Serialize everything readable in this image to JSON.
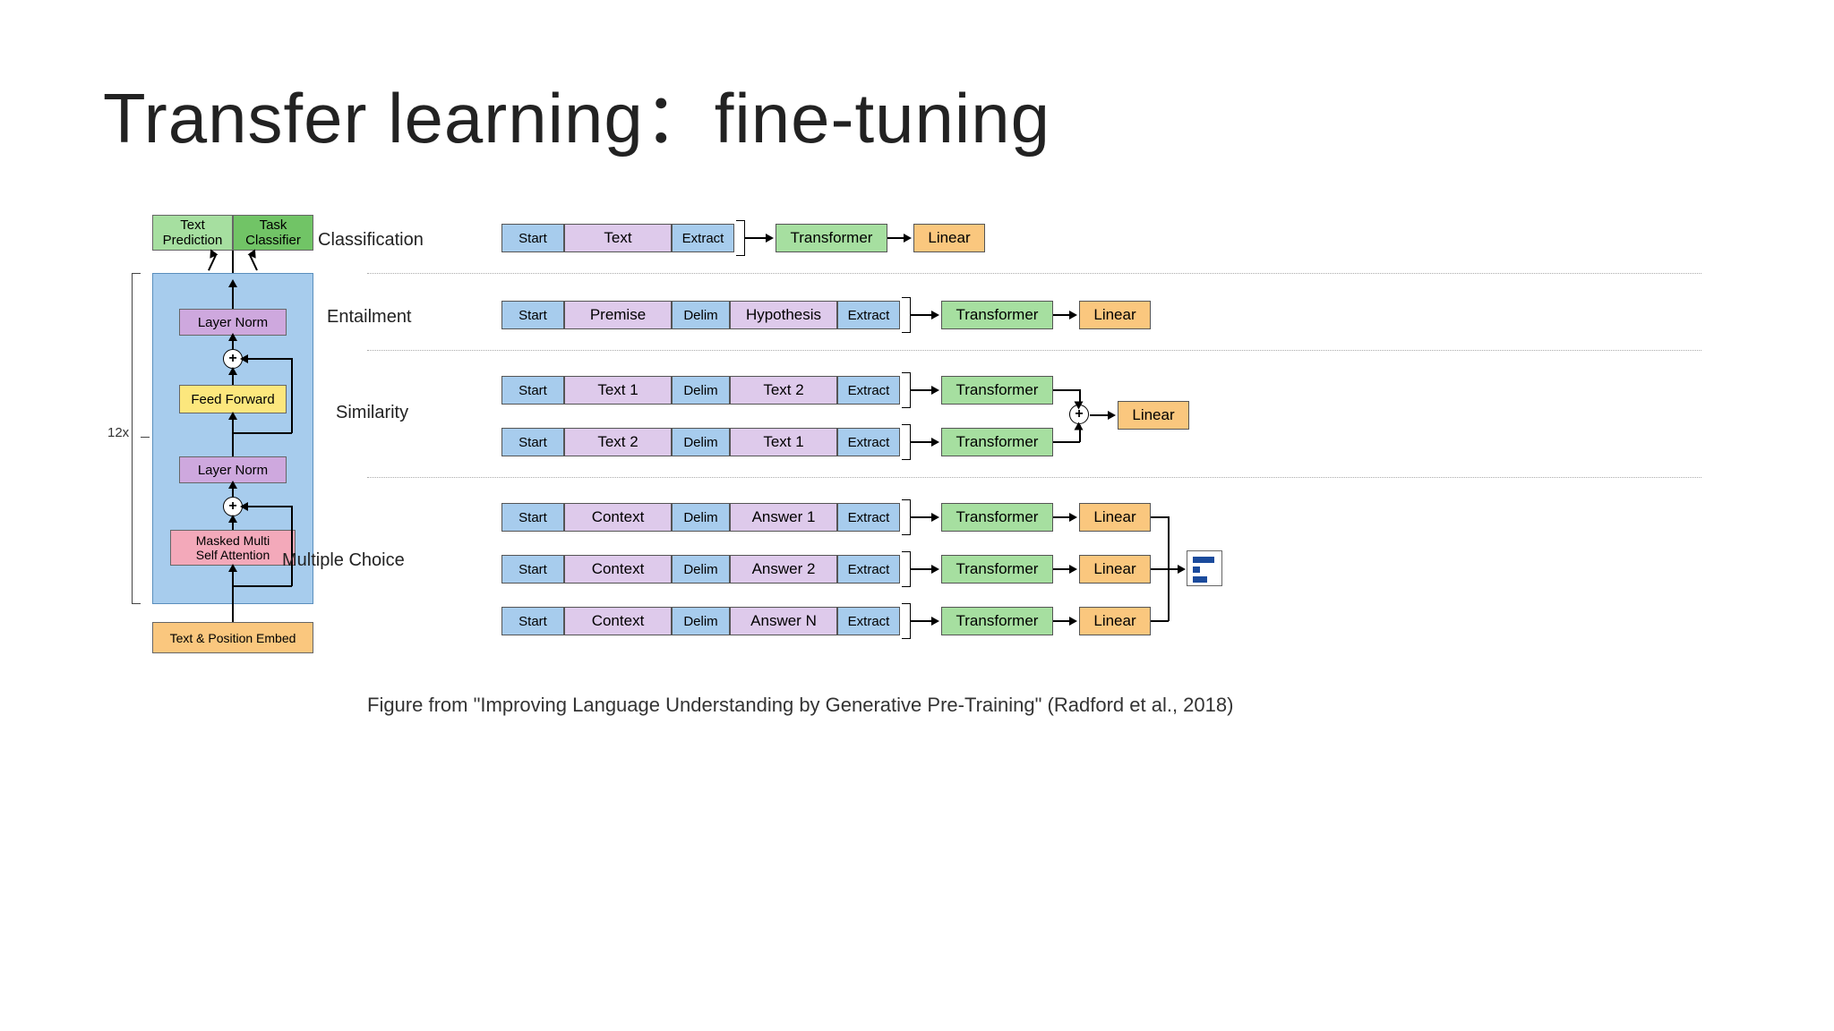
{
  "title": "Transfer learning：fine-tuning",
  "caption_prefix": "Figure from \"",
  "caption_title": "Improving Language Understanding by Generative Pre-Training",
  "caption_suffix": "\" (Radford et al., 2018)",
  "arch": {
    "text_prediction": "Text\nPrediction",
    "task_classifier": "Task\nClassifier",
    "layer_norm": "Layer Norm",
    "feed_forward": "Feed Forward",
    "masked_multi": "Masked Multi\nSelf Attention",
    "embed": "Text & Position Embed",
    "count": "12x"
  },
  "labels": {
    "classification": "Classification",
    "entailment": "Entailment",
    "similarity": "Similarity",
    "multiple_choice": "Multiple Choice",
    "start": "Start",
    "text": "Text",
    "extract": "Extract",
    "premise": "Premise",
    "delim": "Delim",
    "hypothesis": "Hypothesis",
    "text1": "Text 1",
    "text2": "Text 2",
    "context": "Context",
    "answer1": "Answer 1",
    "answer2": "Answer 2",
    "answerN": "Answer N",
    "transformer": "Transformer",
    "linear": "Linear"
  }
}
